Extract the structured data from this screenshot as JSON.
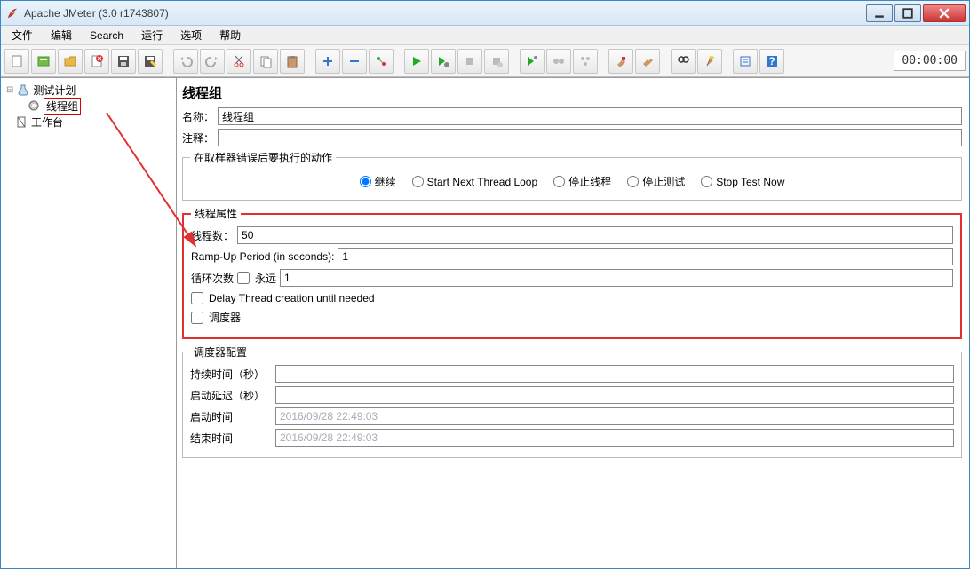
{
  "window": {
    "title": "Apache JMeter (3.0 r1743807)"
  },
  "menu": {
    "file": "文件",
    "edit": "编辑",
    "search": "Search",
    "run": "运行",
    "options": "选项",
    "help": "帮助"
  },
  "timer": "00:00:00",
  "tree": {
    "plan": "测试计划",
    "thread_group": "线程组",
    "workbench": "工作台"
  },
  "panel": {
    "title": "线程组",
    "name_label": "名称：",
    "name_value": "线程组",
    "comment_label": "注释：",
    "comment_value": "",
    "on_error_legend": "在取样器错误后要执行的动作",
    "radios": {
      "continue": "继续",
      "next_loop": "Start Next Thread Loop",
      "stop_thread": "停止线程",
      "stop_test": "停止测试",
      "stop_now": "Stop Test Now"
    },
    "props_legend": "线程属性",
    "threads_label": "线程数：",
    "threads_value": "50",
    "ramp_label": "Ramp-Up Period (in seconds):",
    "ramp_value": "1",
    "loop_label": "循环次数",
    "forever_label": "永远",
    "loop_value": "1",
    "delay_label": "Delay Thread creation until needed",
    "scheduler_label": "调度器",
    "sched_legend": "调度器配置",
    "duration_label": "持续时间（秒）",
    "delay_start_label": "启动延迟（秒）",
    "start_label": "启动时间",
    "start_value": "2016/09/28 22:49:03",
    "end_label": "结束时间",
    "end_value": "2016/09/28 22:49:03"
  }
}
